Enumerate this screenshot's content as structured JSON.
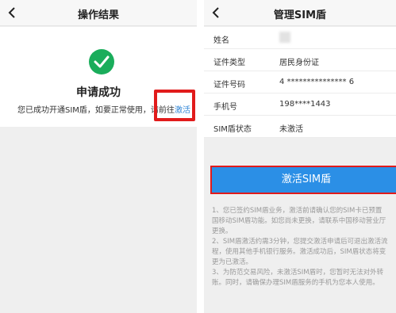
{
  "left_screen": {
    "title": "操作结果",
    "success_title": "申请成功",
    "message_prefix": "您已成功开通SIM盾，如要正常使用，请前往",
    "activate_link": "激活"
  },
  "right_screen": {
    "title": "管理SIM盾",
    "rows": [
      {
        "label": "姓名",
        "value": ""
      },
      {
        "label": "证件类型",
        "value": "居民身份证"
      },
      {
        "label": "证件号码",
        "value": "4 *************** 6"
      },
      {
        "label": "手机号",
        "value": "198****1443"
      },
      {
        "label": "SIM盾状态",
        "value": "未激活"
      }
    ],
    "activate_button": "激活SIM盾",
    "notes": [
      "1、您已签约SIM盾业务，激活前请确认您的SIM卡已预置",
      "国移动SIM盾功能。如您尚未更换，请联系中国移动营业厅",
      "更换。",
      "2、SIM盾激活约需3分钟，您提交激活申请后可退出激活流",
      "程，使用其他手机银行服务。激活成功后，SIM盾状态将变",
      "更为已激活。",
      "3、为防范交易风险，未激活SIM盾时，您暂时无法对外转",
      "账。同时，请确保办理SIM盾服务的手机为您本人使用。"
    ]
  },
  "colors": {
    "success_green": "#1aad5b",
    "link_blue": "#2d84d6",
    "button_blue": "#2b8fe6",
    "highlight_red": "#e11b1b"
  }
}
